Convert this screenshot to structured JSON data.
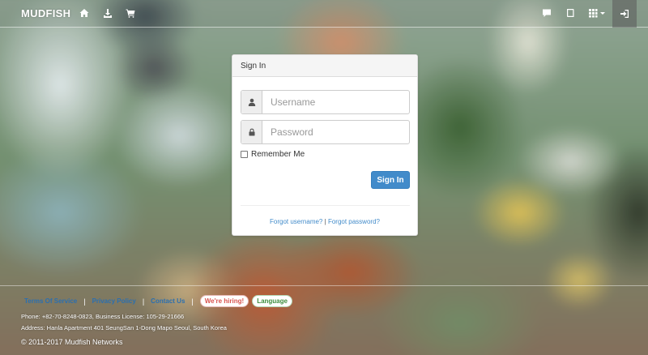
{
  "navbar": {
    "brand": "MUDFISH",
    "icons": [
      "home-icon",
      "download-icon",
      "cart-icon",
      "chat-icon",
      "book-icon",
      "grid-menu-icon",
      "login-icon"
    ]
  },
  "signin": {
    "heading": "Sign In",
    "username_placeholder": "Username",
    "password_placeholder": "Password",
    "remember_label": "Remember Me",
    "button_label": "Sign In",
    "forgot_username": "Forgot username?",
    "separator": "|",
    "forgot_password": "Forgot password?"
  },
  "footer": {
    "links": [
      "Terms Of Service",
      "Privacy Policy",
      "Contact Us"
    ],
    "hiring": "We're hiring!",
    "language": "Language",
    "phone_line": "Phone: +82-70-8248-0823, Business License: 105-29-21666",
    "address_line": "Address: Hanla Apartment 401 SeungSan 1-Dong Mapo Seoul, South Korea",
    "copyright": "© 2011-2017 Mudfish Networks"
  },
  "colors": {
    "primary": "#428bca",
    "hiring": "#d9534f",
    "language": "#3c8d3c"
  }
}
